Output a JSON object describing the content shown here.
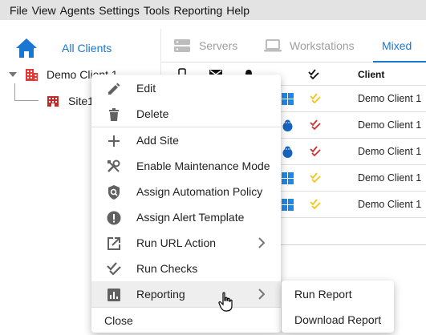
{
  "menubar": {
    "items": [
      "File",
      "View",
      "Agents",
      "Settings",
      "Tools",
      "Reporting",
      "Help"
    ]
  },
  "sidebar": {
    "all_clients": "All Clients",
    "client": "Demo Client 1",
    "site": "Site1"
  },
  "tabs": [
    {
      "label": "Servers",
      "icon": "server-icon",
      "active": false
    },
    {
      "label": "Workstations",
      "icon": "laptop-icon",
      "active": false
    },
    {
      "label": "Mixed",
      "active": true
    }
  ],
  "table": {
    "header_icons": [
      "phone-icon",
      "mail-icon",
      "alert-icon",
      "check-icon"
    ],
    "client_header": "Client",
    "rows": [
      {
        "os": "windows",
        "check": "yellow",
        "client": "Demo Client 1"
      },
      {
        "os": "linux",
        "check": "red",
        "client": "Demo Client 1"
      },
      {
        "os": "linux",
        "check": "red",
        "client": "Demo Client 1"
      },
      {
        "os": "windows",
        "check": "yellow",
        "client": "Demo Client 1"
      },
      {
        "os": "windows",
        "check": "yellow",
        "client": "Demo Client 1"
      }
    ]
  },
  "context_menu": {
    "items": [
      {
        "label": "Edit",
        "icon": "pencil-icon"
      },
      {
        "label": "Delete",
        "icon": "trash-icon"
      },
      {
        "label": "Add Site",
        "icon": "plus-icon"
      },
      {
        "label": "Enable Maintenance Mode",
        "icon": "tools-icon"
      },
      {
        "label": "Assign Automation Policy",
        "icon": "policy-icon"
      },
      {
        "label": "Assign Alert Template",
        "icon": "alert-icon"
      },
      {
        "label": "Run URL Action",
        "icon": "open-link-icon"
      },
      {
        "label": "Run Checks",
        "icon": "checks-icon"
      },
      {
        "label": "Reporting",
        "icon": "report-icon"
      },
      {
        "label": "Close"
      }
    ]
  },
  "submenu": {
    "items": [
      "Run Report",
      "Download Report"
    ]
  },
  "colors": {
    "accent": "#1976d2",
    "client_icon": "#e53935",
    "check_yellow": "#f5c518",
    "check_red": "#d32f2f",
    "windows": "#1e88e5",
    "linux": "#1565c0"
  }
}
